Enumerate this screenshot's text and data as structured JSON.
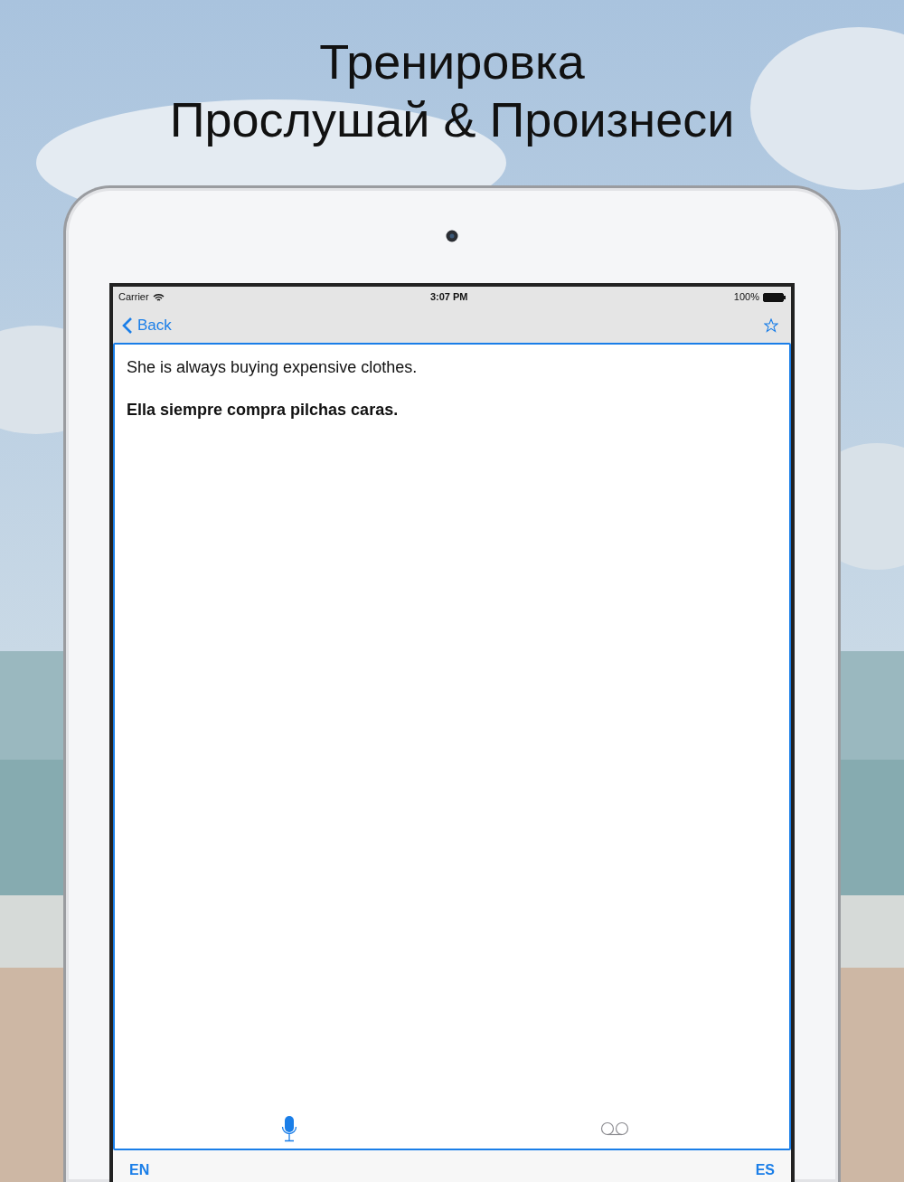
{
  "headline": [
    "Тренировка",
    "Прослушай & Произнеси"
  ],
  "status_bar": {
    "carrier": "Carrier",
    "time": "3:07 PM",
    "battery": "100%"
  },
  "nav": {
    "back": "Back"
  },
  "sentences": [
    {
      "text": "She is always buying expensive clothes.",
      "bold": false
    },
    {
      "text": "Ella siempre compra pilchas caras.",
      "bold": true
    }
  ],
  "tools": [
    {
      "kind": "mic",
      "active": true
    },
    {
      "kind": "playback",
      "active": false
    }
  ],
  "languages": [
    "EN",
    "ES"
  ]
}
